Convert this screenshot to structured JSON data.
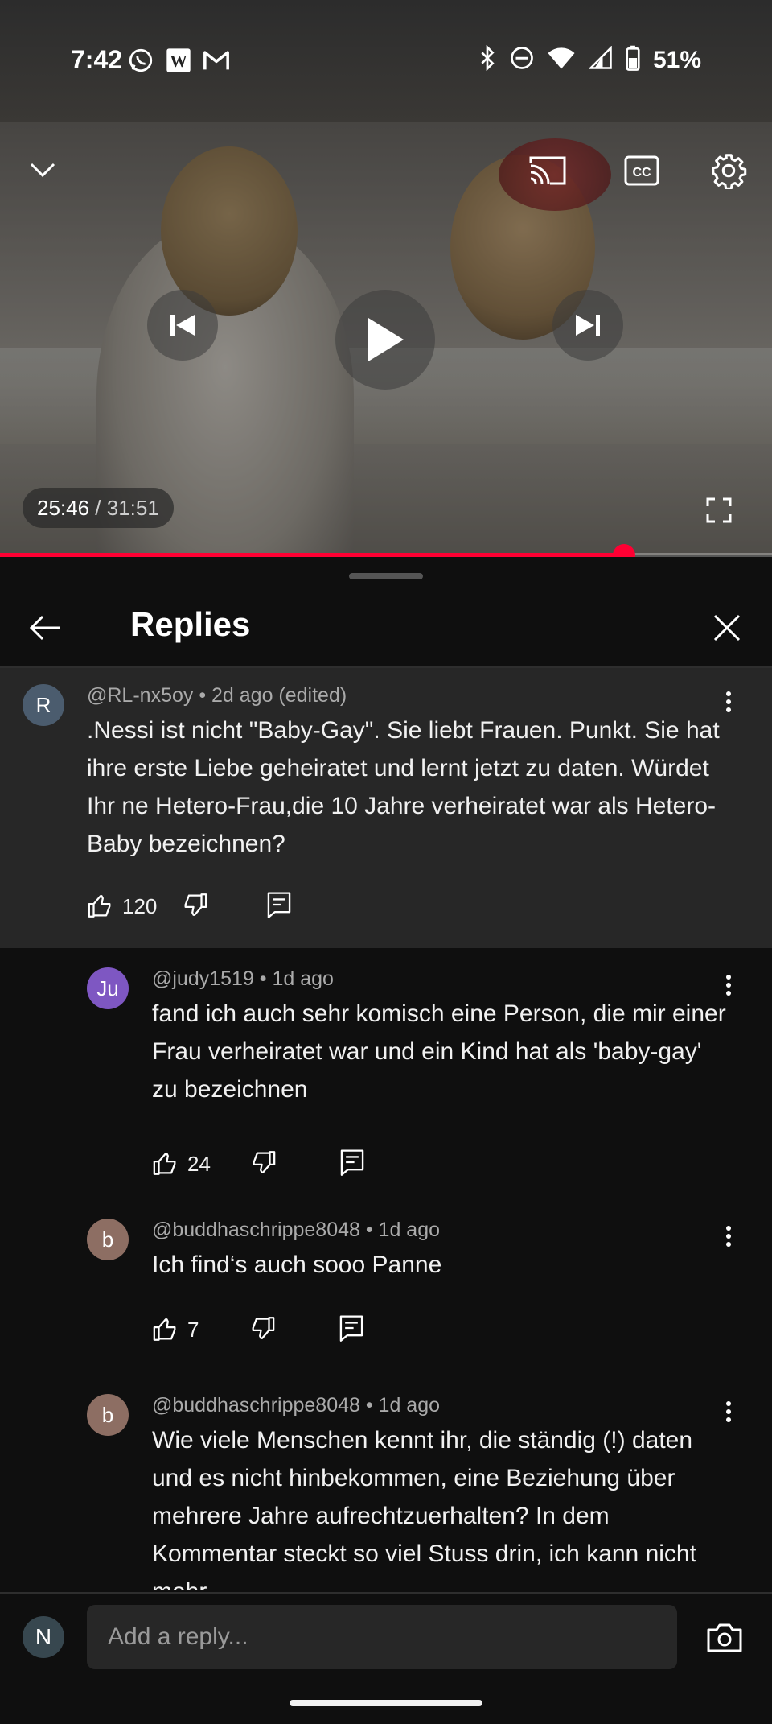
{
  "status_bar": {
    "time": "7:42",
    "battery_percent": "51%",
    "left_icons": [
      "whatsapp-icon",
      "w-app-icon",
      "gmail-icon"
    ],
    "right_icons": [
      "bluetooth-icon",
      "do-not-disturb-icon",
      "wifi-icon",
      "signal-icon",
      "battery-icon"
    ]
  },
  "player": {
    "current_time": "25:46",
    "separator": " / ",
    "duration": "31:51",
    "progress_fraction": 0.808,
    "accent_color": "#ff0033"
  },
  "replies_panel": {
    "title": "Replies",
    "parent_comment": {
      "avatar_letter": "R",
      "avatar_color": "#4b5c6e",
      "meta": "@RL-nx5oy • 2d ago (edited)",
      "text": ".Nessi ist nicht \"Baby-Gay\". Sie liebt Frauen. Punkt. Sie hat ihre erste Liebe geheiratet und lernt jetzt zu daten. Würdet Ihr ne Hetero-Frau,die 10 Jahre verheiratet war als Hetero-Baby bezeichnen?",
      "likes": "120"
    },
    "replies": [
      {
        "avatar_letter": "Ju",
        "avatar_color": "#7e57c2",
        "meta": "@judy1519 • 1d ago",
        "text": "fand ich auch sehr komisch eine Person, die mir einer Frau verheiratet war und ein Kind hat als 'baby-gay' zu bezeichnen",
        "likes": "24"
      },
      {
        "avatar_letter": "b",
        "avatar_color": "#8d6e63",
        "meta": "@buddhaschrippe8048 • 1d ago",
        "text": "Ich find‘s auch sooo Panne",
        "likes": "7"
      },
      {
        "avatar_letter": "b",
        "avatar_color": "#8d6e63",
        "meta": "@buddhaschrippe8048 • 1d ago",
        "text": "Wie viele Menschen kennt ihr, die ständig (!) daten und es nicht hinbekommen, eine Beziehung über mehrere Jahre aufrechtzuerhalten? In dem Kommentar steckt so viel Stuss drin, ich kann nicht mehr"
      }
    ]
  },
  "reply_input": {
    "user_avatar_letter": "N",
    "user_avatar_color": "#37474f",
    "placeholder": "Add a reply..."
  }
}
